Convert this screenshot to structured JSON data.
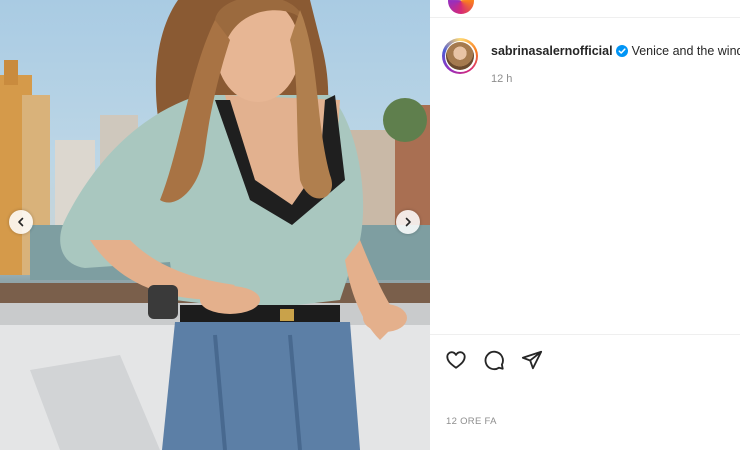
{
  "post": {
    "username": "sabrinasalernofficial",
    "caption": "Venice and the wind",
    "time_ago": "12 h",
    "date": "12 ORE FA",
    "verified": true
  },
  "icons": {
    "prev": "chevron-left-icon",
    "next": "chevron-right-icon",
    "like": "heart-icon",
    "comment": "comment-bubble-icon",
    "share": "paper-plane-icon",
    "verified": "verified-badge-icon"
  },
  "colors": {
    "verified_blue": "#0095f6",
    "secondary_text": "#8e8e8e",
    "divider": "#efefef"
  }
}
